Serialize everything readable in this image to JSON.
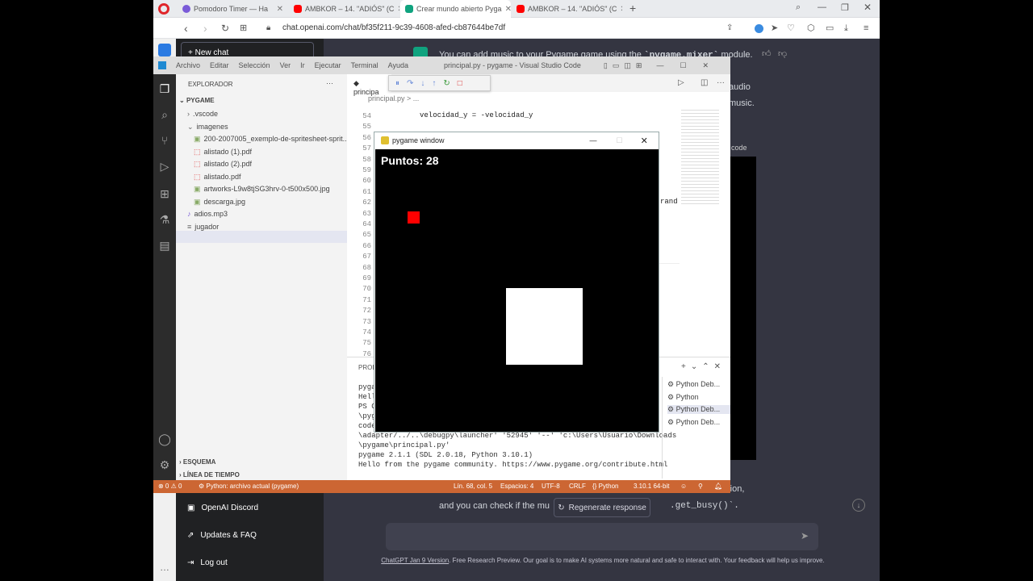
{
  "browser": {
    "tabs": [
      {
        "label": "Pomodoro Timer — Ha",
        "icon": "clock-icon",
        "color": "#7a5bd8"
      },
      {
        "label": "AMBKOR – 14. \"ADIÓS\" (C",
        "icon": "youtube-icon",
        "color": "#ff0000"
      },
      {
        "label": "Crear mundo abierto Pyga",
        "icon": "chatgpt-icon",
        "color": "#10a37f"
      },
      {
        "label": "AMBKOR – 14. \"ADIÓS\" (C",
        "icon": "youtube-icon",
        "color": "#ff0000"
      }
    ],
    "url": "chat.openai.com/chat/bf35f211-9c39-4608-afed-cb87644be7df"
  },
  "chat": {
    "line1_prefix": "You can add music to your Pygame game using the ",
    "line1_code": "`pygame.mixer`",
    "line1_suffix": " module.",
    "frag_audio": "audio",
    "frag_music": "music.",
    "frag_code": "code",
    "frag_function": "nction,",
    "bottom_line_a": "and you can check if the mu",
    "bottom_line_b": ".get_busy()`.",
    "regenerate": "Regenerate response",
    "new_chat": "+ New chat",
    "side_links": [
      "OpenAI Discord",
      "Updates & FAQ",
      "Log out"
    ],
    "footer_link": "ChatGPT Jan 9 Version",
    "footer_text": ". Free Research Preview. Our goal is to make AI systems more natural and safe to interact with. Your feedback will help us improve."
  },
  "vscode": {
    "menu": [
      "Archivo",
      "Editar",
      "Selección",
      "Ver",
      "Ir",
      "Ejecutar",
      "Terminal",
      "Ayuda"
    ],
    "title": "principal.py - pygame - Visual Studio Code",
    "explorer_title": "EXPLORADOR",
    "folder": "PYGAME",
    "tree": [
      {
        "label": ".vscode",
        "indent": 1,
        "icon": "chevron-right-icon"
      },
      {
        "label": "imagenes",
        "indent": 1,
        "icon": "chevron-down-icon"
      },
      {
        "label": "200-2007005_exemplo-de-spritesheet-sprit...",
        "indent": 2,
        "icon": "image-icon"
      },
      {
        "label": "alistado (1).pdf",
        "indent": 2,
        "icon": "pdf-icon"
      },
      {
        "label": "alistado (2).pdf",
        "indent": 2,
        "icon": "pdf-icon"
      },
      {
        "label": "alistado.pdf",
        "indent": 2,
        "icon": "pdf-icon"
      },
      {
        "label": "artworks-L9w8tjSG3hrv-0-t500x500.jpg",
        "indent": 2,
        "icon": "image-icon"
      },
      {
        "label": "descarga.jpg",
        "indent": 2,
        "icon": "image-icon"
      },
      {
        "label": "adios.mp3",
        "indent": 1,
        "icon": "audio-icon"
      },
      {
        "label": "jugador",
        "indent": 1,
        "icon": "file-icon"
      },
      {
        "label": "principal.py",
        "indent": 1,
        "icon": "python-icon"
      }
    ],
    "outline": "ESQUEMA",
    "timeline": "LÍNEA DE TIEMPO",
    "tab": "principa",
    "breadcrumb": "principal.py > ...",
    "line_numbers": [
      "54",
      "55",
      "56",
      "57",
      "58",
      "59",
      "60",
      "61",
      "62",
      "63",
      "64",
      "65",
      "66",
      "67",
      "68",
      "69",
      "70",
      "71",
      "72",
      "73",
      "74",
      "75",
      "76"
    ],
    "code_line": "velocidad_y = -velocidad_y",
    "code_frag_rand": "rand",
    "panel_label": "PROB",
    "terminal": [
      "pyga",
      "Hell",
      "PS C",
      "\\pyg",
      "code",
      "\\adapter/../..\\debugpy\\launcher' '52945' '--' 'c:\\Users\\Usuario\\Downloads",
      "\\pygame\\principal.py'",
      "pygame 2.1.1 (SDL 2.0.18, Python 3.10.1)",
      "Hello from the pygame community. https://www.pygame.org/contribute.html"
    ],
    "terminals": [
      "Python Deb...",
      "Python",
      "Python Deb...",
      "Python Deb..."
    ],
    "status": {
      "errors": "⊗ 0 ⚠ 0",
      "interpreter": "Python: archivo actual (pygame)",
      "position": "Lín. 68, col. 5",
      "spaces": "Espacios: 4",
      "encoding": "UTF-8",
      "eol": "CRLF",
      "language": "Python",
      "version": "3.10.1 64-bit"
    }
  },
  "pygame": {
    "title": "pygame window",
    "score": "Puntos: 28"
  }
}
